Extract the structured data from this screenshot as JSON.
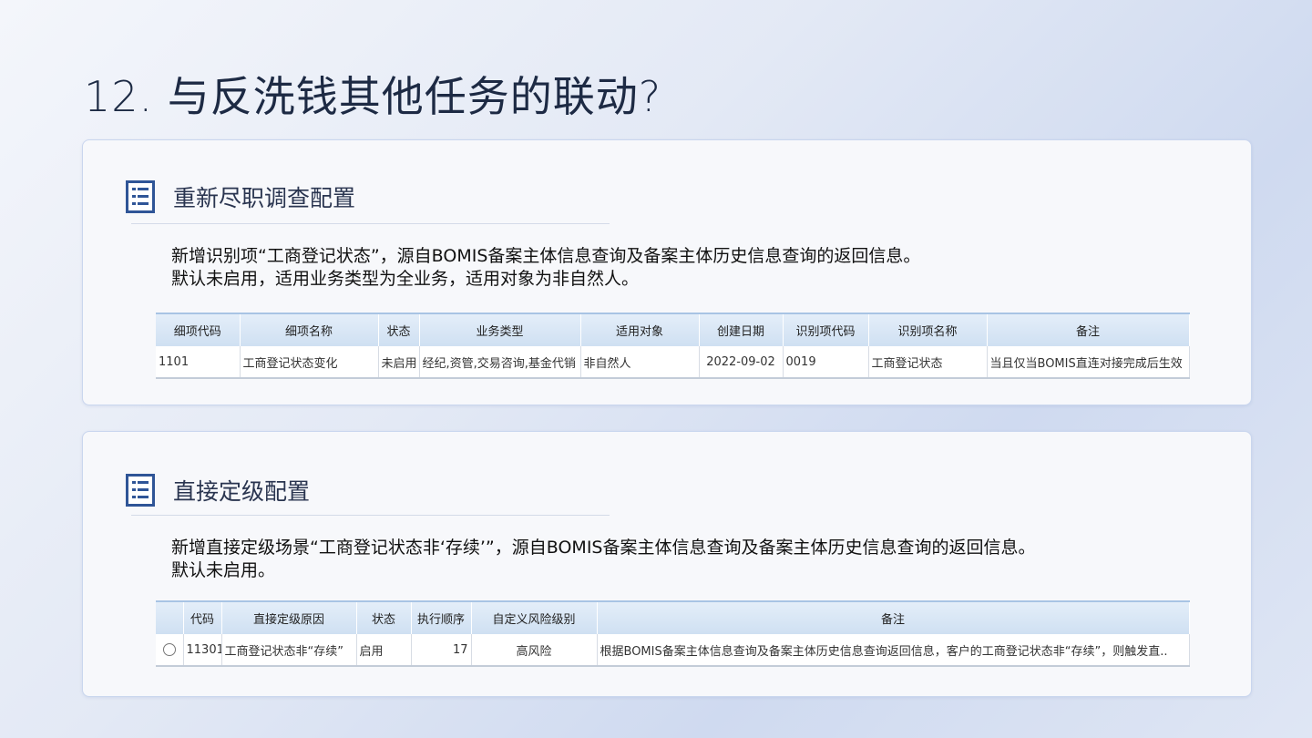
{
  "title": "12. 与反洗钱其他任务的联动?",
  "section1": {
    "heading": "重新尽职调查配置",
    "desc_line1": "新增识别项“工商登记状态”，源自BOMIS备案主体信息查询及备案主体历史信息查询的返回信息。",
    "desc_line2": "默认未启用，适用业务类型为全业务，适用对象为非自然人。",
    "columns": [
      "细项代码",
      "细项名称",
      "状态",
      "业务类型",
      "适用对象",
      "创建日期",
      "识别项代码",
      "识别项名称",
      "备注"
    ],
    "row": {
      "code": "1101",
      "name": "工商登记状态变化",
      "status": "未启用",
      "biz_type": "经纪,资管,交易咨询,基金代销",
      "target": "非自然人",
      "created": "2022-09-02",
      "item_code": "0019",
      "item_name": "工商登记状态",
      "remark": "当且仅当BOMIS直连对接完成后生效"
    }
  },
  "section2": {
    "heading": "直接定级配置",
    "desc_line1": "新增直接定级场景“工商登记状态非‘存续’”，源自BOMIS备案主体信息查询及备案主体历史信息查询的返回信息。",
    "desc_line2": "默认未启用。",
    "columns": [
      "",
      "代码",
      "直接定级原因",
      "状态",
      "执行顺序",
      "自定义风险级别",
      "备注"
    ],
    "row": {
      "code": "11301",
      "reason": "工商登记状态非“存续”",
      "status": "启用",
      "order": "17",
      "risk": "高风险",
      "remark": "根据BOMIS备案主体信息查询及备案主体历史信息查询返回信息，客户的工商登记状态非“存续”，则触发直.."
    }
  }
}
